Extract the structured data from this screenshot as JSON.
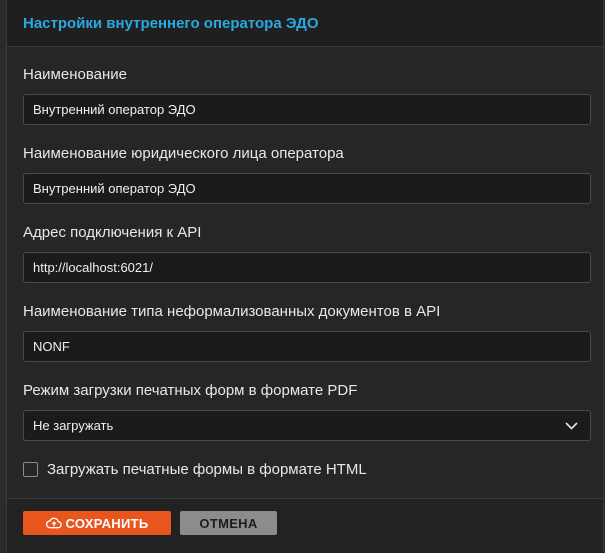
{
  "dialog": {
    "title": "Настройки внутреннего оператора ЭДО"
  },
  "fields": {
    "name": {
      "label": "Наименование",
      "value": "Внутренний оператор ЭДО"
    },
    "legal_name": {
      "label": "Наименование юридического лица оператора",
      "value": "Внутренний оператор ЭДО"
    },
    "api_address": {
      "label": "Адрес подключения к API",
      "value": "http://localhost:6021/"
    },
    "doc_type_name": {
      "label": "Наименование типа неформализованных документов в API",
      "value": "NONF"
    },
    "pdf_mode": {
      "label": "Режим загрузки печатных форм в формате PDF",
      "value": "Не загружать"
    }
  },
  "html_checkbox": {
    "label": "Загружать печатные формы в формате HTML",
    "checked": false
  },
  "buttons": {
    "save": "СОХРАНИТЬ",
    "cancel": "ОТМЕНА"
  },
  "icons": {
    "save": "cloud-upload-icon",
    "select": "chevron-down-icon"
  },
  "colors": {
    "accent": "#29a9e0",
    "save_button": "#e8561e",
    "cancel_button": "#8c8c8c"
  }
}
